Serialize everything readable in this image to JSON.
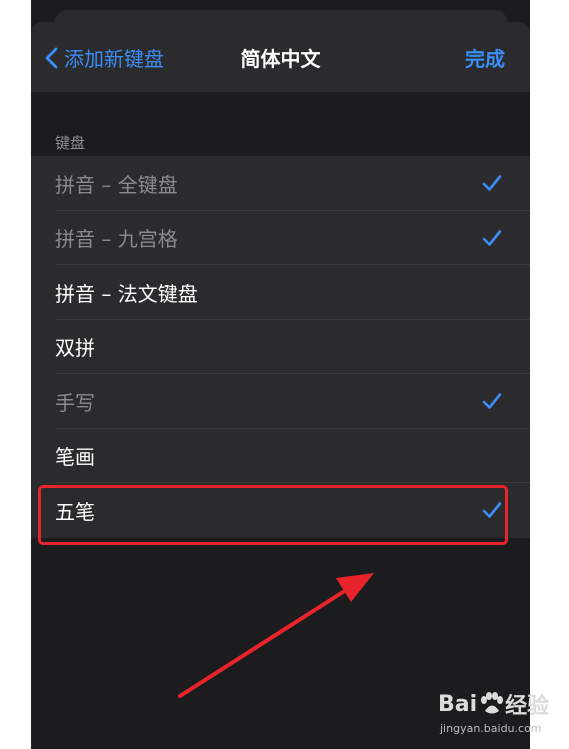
{
  "navbar": {
    "back_label": "添加新键盘",
    "title": "简体中文",
    "done_label": "完成"
  },
  "section": {
    "header": "键盘"
  },
  "keyboards": [
    {
      "label": "拼音 – 全键盘",
      "checked": true,
      "dim": true
    },
    {
      "label": "拼音 – 九宫格",
      "checked": true,
      "dim": true
    },
    {
      "label": "拼音 – 法文键盘",
      "checked": false,
      "dim": false
    },
    {
      "label": "双拼",
      "checked": false,
      "dim": false
    },
    {
      "label": "手写",
      "checked": true,
      "dim": true
    },
    {
      "label": "笔画",
      "checked": false,
      "dim": false
    },
    {
      "label": "五笔",
      "checked": true,
      "dim": false
    }
  ],
  "watermark": {
    "brand_left": "Bai",
    "brand_right": "经验",
    "url": "jingyan.baidu.com"
  },
  "colors": {
    "accent": "#3a8df6",
    "annotation_red": "#e8242a"
  }
}
